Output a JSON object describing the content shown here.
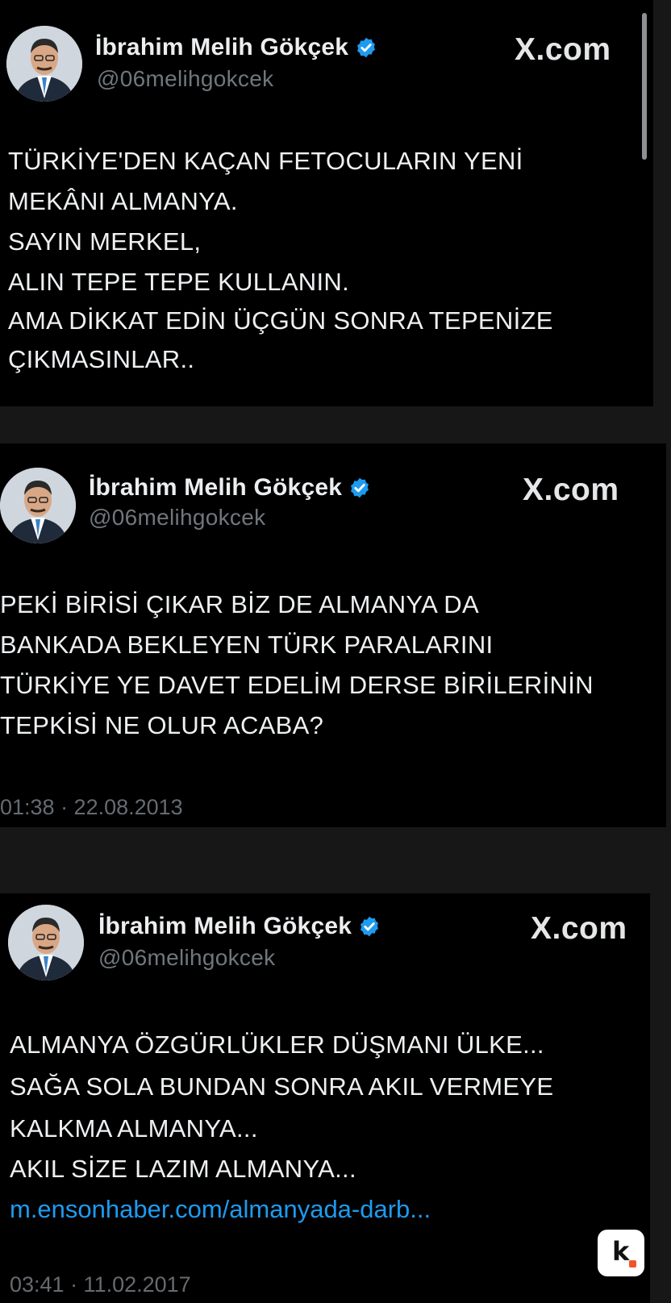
{
  "brand": {
    "x_domain": "X.com",
    "verified_color": "#1d9bf0",
    "link_color": "#1d9bf0"
  },
  "tweets": [
    {
      "author_name": "İbrahim Melih Gökçek",
      "handle": "@06melihgokcek",
      "lines": [
        "TÜRKİYE'DEN KAÇAN FETOCULARIN YENİ",
        "MEKÂNI ALMANYA.",
        "SAYIN MERKEL,",
        "ALIN TEPE TEPE KULLANIN.",
        "AMA DİKKAT EDİN ÜÇGÜN SONRA TEPENİZE",
        "ÇIKMASINLAR.."
      ]
    },
    {
      "author_name": "İbrahim Melih Gökçek",
      "handle": "@06melihgokcek",
      "lines": [
        "PEKİ BİRİSİ ÇIKAR BİZ DE ALMANYA DA",
        "BANKADA BEKLEYEN TÜRK PARALARINI",
        "TÜRKİYE YE DAVET EDELİM DERSE BİRİLERİNİN",
        "TEPKİSİ NE OLUR ACABA?"
      ],
      "timestamp": "01:38 · 22.08.2013"
    },
    {
      "author_name": "İbrahim Melih Gökçek",
      "handle": "@06melihgokcek",
      "lines": [
        "ALMANYA ÖZGÜRLÜKLER DÜŞMANI ÜLKE...",
        "SAĞA SOLA BUNDAN SONRA AKIL VERMEYE",
        "KALKMA ALMANYA...",
        "AKIL SİZE LAZIM ALMANYA..."
      ],
      "link": "m.ensonhaber.com/almanyada-darb...",
      "timestamp": "03:41 · 11.02.2017"
    }
  ],
  "badge": {
    "letter": "k",
    "dot_color": "#f0552a"
  }
}
